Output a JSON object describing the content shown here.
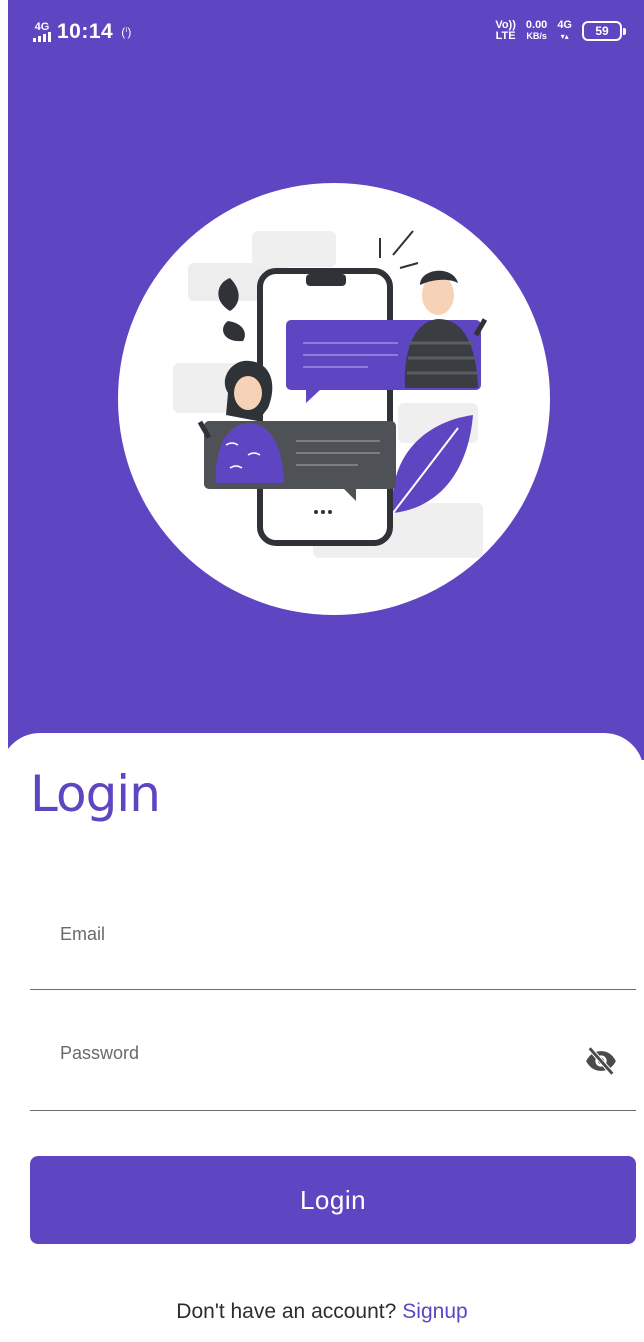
{
  "status_bar": {
    "network_left": "4G",
    "time": "10:14",
    "volte_top": "Vo))",
    "volte_bottom": "LTE",
    "speed_value": "0.00",
    "speed_unit": "KB/s",
    "network_right": "4G",
    "battery": "59"
  },
  "login": {
    "title": "Login",
    "email_placeholder": "Email",
    "password_placeholder": "Password",
    "button_label": "Login",
    "footer_text": "Don't have an account?",
    "signup_link": "Signup"
  },
  "colors": {
    "primary": "#5e45c1",
    "background": "#ffffff",
    "text_muted": "#6a6a6a",
    "phone_frame": "#2f3236"
  },
  "icons": {
    "password_toggle": "eye-off-icon",
    "illustration": "chat-illustration"
  }
}
